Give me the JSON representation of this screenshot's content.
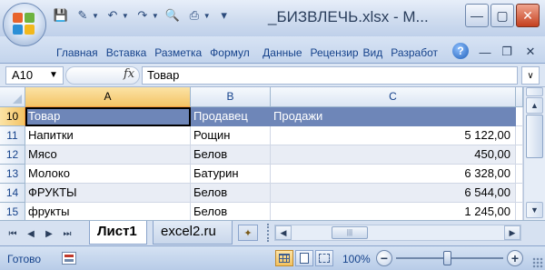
{
  "window": {
    "title": "_БИЗВЛЕЧЬ.xlsx - M..."
  },
  "ribbon": {
    "tabs": [
      "Главная",
      "Вставка",
      "Разметка",
      "Формул",
      "Данные",
      "Рецензир",
      "Вид",
      "Разработ"
    ],
    "help_label": "?"
  },
  "formula_bar": {
    "name_box": "A10",
    "fx_label": "fx",
    "formula": "Товар"
  },
  "grid": {
    "columns": [
      "A",
      "B",
      "C"
    ],
    "rows": [
      {
        "num": "10",
        "cells": [
          "Товар",
          "Продавец",
          "Продажи"
        ]
      },
      {
        "num": "11",
        "cells": [
          "Напитки",
          "Рощин",
          "5 122,00"
        ]
      },
      {
        "num": "12",
        "cells": [
          "Мясо",
          "Белов",
          "450,00"
        ]
      },
      {
        "num": "13",
        "cells": [
          "Молоко",
          "Батурин",
          "6 328,00"
        ]
      },
      {
        "num": "14",
        "cells": [
          "ФРУКТЫ",
          "Белов",
          "6 544,00"
        ]
      },
      {
        "num": "15",
        "cells": [
          "фрукты",
          "Белов",
          "1 245,00"
        ]
      }
    ],
    "active_cell": "A10"
  },
  "sheets": {
    "tabs": [
      "Лист1",
      "excel2.ru"
    ],
    "active": "Лист1"
  },
  "status": {
    "text": "Готово",
    "zoom": "100%"
  },
  "colors": {
    "table_header_bg": "#6e86b8",
    "banded_row_bg": "#e9edf5",
    "selected_header": "#f4c465"
  }
}
